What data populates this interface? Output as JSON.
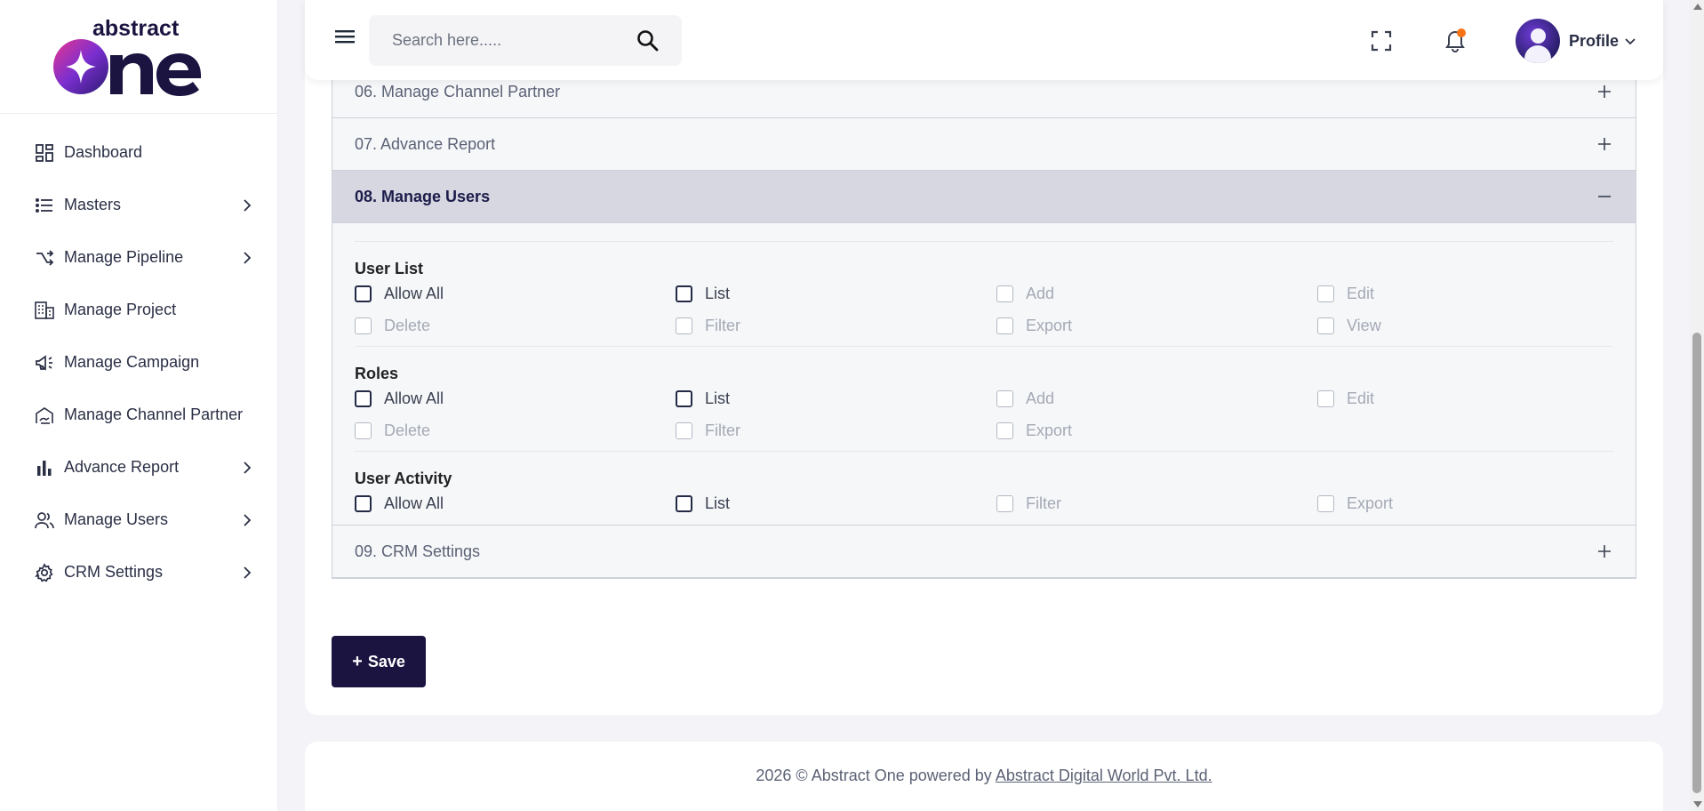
{
  "brand": {
    "logo_top": "abstract",
    "logo_bottom": "One"
  },
  "sidebar": {
    "items": [
      {
        "label": "Dashboard",
        "icon": "dashboard-icon",
        "has_children": false
      },
      {
        "label": "Masters",
        "icon": "list-icon",
        "has_children": true
      },
      {
        "label": "Manage Pipeline",
        "icon": "pipeline-icon",
        "has_children": true
      },
      {
        "label": "Manage Project",
        "icon": "building-icon",
        "has_children": false
      },
      {
        "label": "Manage Campaign",
        "icon": "megaphone-icon",
        "has_children": false
      },
      {
        "label": "Manage Channel Partner",
        "icon": "handshake-icon",
        "has_children": false
      },
      {
        "label": "Advance Report",
        "icon": "bar-chart-icon",
        "has_children": true
      },
      {
        "label": "Manage Users",
        "icon": "users-icon",
        "has_children": true
      },
      {
        "label": "CRM Settings",
        "icon": "gear-icon",
        "has_children": true
      }
    ]
  },
  "header": {
    "search_placeholder": "Search here.....",
    "profile_label": "Profile",
    "notification_dot_color": "#f97316"
  },
  "accordion": {
    "sections": [
      {
        "title": "06. Manage Channel Partner",
        "open": false
      },
      {
        "title": "07. Advance Report",
        "open": false
      },
      {
        "title": "08. Manage Users",
        "open": true
      },
      {
        "title": "09. CRM Settings",
        "open": false
      }
    ],
    "open_section": {
      "groups": [
        {
          "title": "User List",
          "perms": [
            {
              "label": "Allow All",
              "enabled": true,
              "checked": false
            },
            {
              "label": "List",
              "enabled": true,
              "checked": false
            },
            {
              "label": "Add",
              "enabled": false,
              "checked": false
            },
            {
              "label": "Edit",
              "enabled": false,
              "checked": false
            },
            {
              "label": "Delete",
              "enabled": false,
              "checked": false
            },
            {
              "label": "Filter",
              "enabled": false,
              "checked": false
            },
            {
              "label": "Export",
              "enabled": false,
              "checked": false
            },
            {
              "label": "View",
              "enabled": false,
              "checked": false
            }
          ]
        },
        {
          "title": "Roles",
          "perms": [
            {
              "label": "Allow All",
              "enabled": true,
              "checked": false
            },
            {
              "label": "List",
              "enabled": true,
              "checked": false
            },
            {
              "label": "Add",
              "enabled": false,
              "checked": false
            },
            {
              "label": "Edit",
              "enabled": false,
              "checked": false
            },
            {
              "label": "Delete",
              "enabled": false,
              "checked": false
            },
            {
              "label": "Filter",
              "enabled": false,
              "checked": false
            },
            {
              "label": "Export",
              "enabled": false,
              "checked": false
            }
          ]
        },
        {
          "title": "User Activity",
          "perms": [
            {
              "label": "Allow All",
              "enabled": true,
              "checked": false
            },
            {
              "label": "List",
              "enabled": true,
              "checked": false
            },
            {
              "label": "Filter",
              "enabled": false,
              "checked": false
            },
            {
              "label": "Export",
              "enabled": false,
              "checked": false
            }
          ]
        }
      ]
    }
  },
  "actions": {
    "save_label": "Save"
  },
  "footer": {
    "text": "2026 © Abstract One powered by",
    "link": "Abstract Digital World Pvt. Ltd."
  },
  "colors": {
    "brand_dark": "#1b1340",
    "accent_purple": "#6d3bd6",
    "open_header_bg": "#d6d7e1"
  }
}
